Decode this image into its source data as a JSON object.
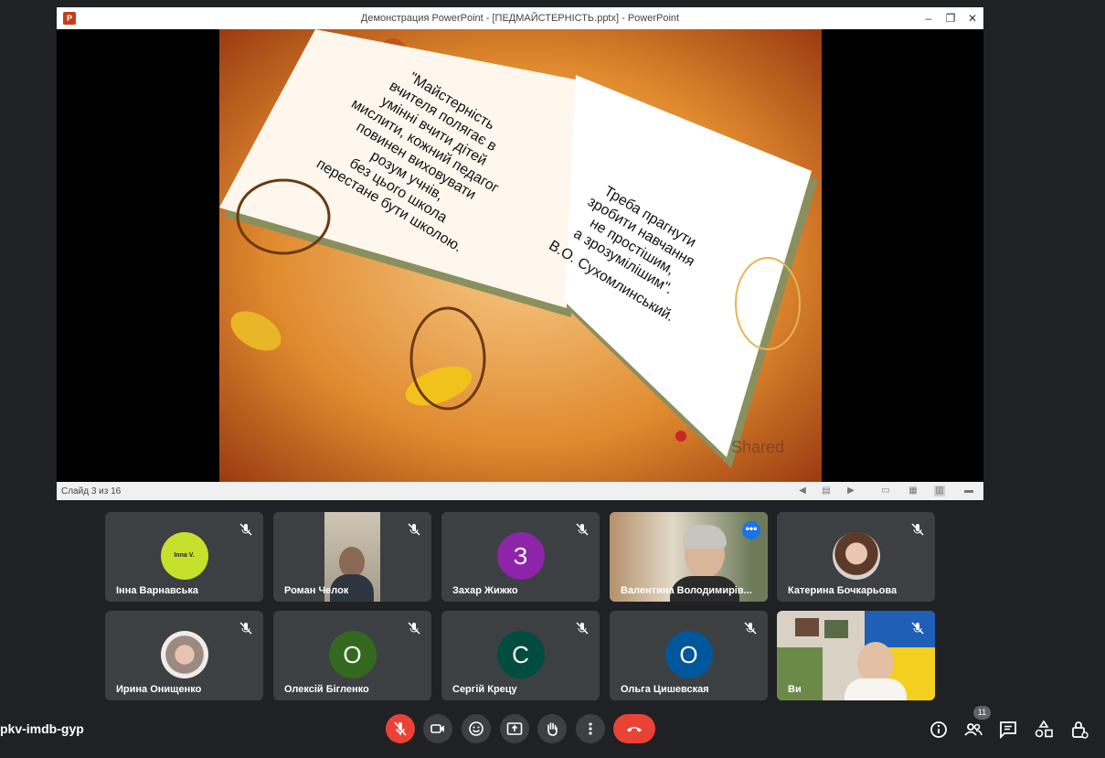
{
  "ppt": {
    "window_title": "Демонстрация PowerPoint - [ПЕДМАЙСТЕРНІСТЬ.pptx] - PowerPoint",
    "slide_status": "Слайд 3 из 16",
    "logo_letter": "P",
    "left_page_text": [
      "\"Майстерність",
      "вчителя полягає в",
      "умінні вчити дітей",
      "мислити, кожний педагог",
      "повинен виховувати",
      "розум учнів,",
      "без цього школа",
      "перестане бути школою."
    ],
    "right_page_text": [
      "Треба прагнути",
      "зробити навчання",
      "не простішим,",
      "а зрозумілішим\".",
      "В.О. Сухомлинський."
    ],
    "watermark": "Shared"
  },
  "participants": [
    {
      "name": "Інна Варнавська",
      "avatar_text": "Inna V.",
      "avatar_color": "#c6e12b",
      "type": "avatar-small"
    },
    {
      "name": "Роман Челок",
      "type": "video"
    },
    {
      "name": "Захар Жижко",
      "avatar_text": "З",
      "avatar_color": "#8e24aa",
      "type": "avatar"
    },
    {
      "name": "Валентина Володимирів...",
      "type": "video",
      "speaking": true
    },
    {
      "name": "Катерина Бочкарьова",
      "type": "photo"
    },
    {
      "name": "Ирина Онищенко",
      "type": "photo"
    },
    {
      "name": "Олексій Бігленко",
      "avatar_text": "О",
      "avatar_color": "#33691e",
      "type": "avatar"
    },
    {
      "name": "Сергій Крецу",
      "avatar_text": "С",
      "avatar_color": "#004d40",
      "type": "avatar"
    },
    {
      "name": "Ольга Цишевская",
      "avatar_text": "О",
      "avatar_color": "#01579b",
      "type": "avatar"
    },
    {
      "name": "Ви",
      "type": "video"
    }
  ],
  "meeting": {
    "code": "pkv-imdb-gyp",
    "participant_count": "11"
  },
  "colors": {
    "end_call": "#ea4335",
    "accent": "#8ab4f8",
    "background": "#202124"
  }
}
